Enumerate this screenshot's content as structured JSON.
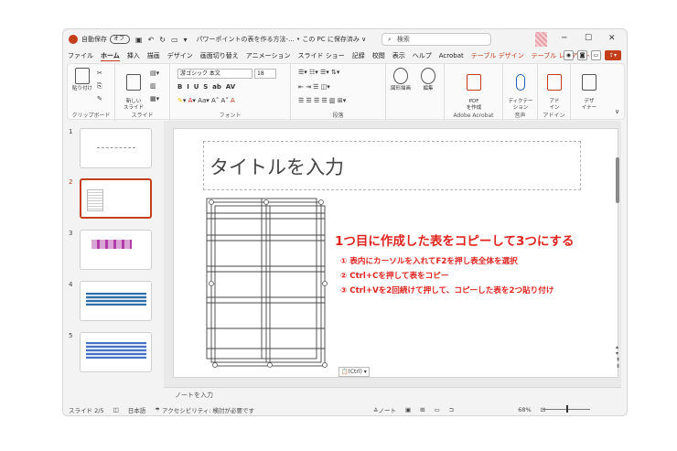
{
  "titlebar": {
    "autosave": "自動保存",
    "toggle": "オフ",
    "docname": "パワーポイントの表を作る方法-... • この PC に保存済み ∨",
    "search_placeholder": "検索",
    "minimize": "─",
    "maximize": "☐",
    "close": "✕"
  },
  "tabs": [
    "ファイル",
    "ホーム",
    "挿入",
    "描画",
    "デザイン",
    "画面切り替え",
    "アニメーション",
    "スライド ショー",
    "記録",
    "校閲",
    "表示",
    "ヘルプ",
    "Acrobat",
    "テーブル デザイン",
    "テーブル レイアウト"
  ],
  "active_tab": "ホーム",
  "ribbon": {
    "paste": "貼り付け",
    "new_slide": "新しい\nスライド",
    "font_name": "游ゴシック 本文",
    "font_size": "18",
    "draw_shape": "図形描画",
    "edit": "編集",
    "pdf": "PDF\nを作成",
    "dictate": "ディクテー\nション",
    "addins": "アド\nイン",
    "designer": "デザ\nイナー",
    "groups": [
      "クリップボード",
      "スライド",
      "フォント",
      "段落",
      "Adobe Acrobat",
      "音声",
      "アドイン"
    ]
  },
  "thumbnails": [
    "1",
    "2",
    "3",
    "4",
    "5"
  ],
  "slide": {
    "title_placeholder": "タイトルを入力",
    "annotation_heading": "1つ目に作成した表をコピーして3つにする",
    "steps": [
      "① 表内にカーソルを入れてF2を押し表全体を選択",
      "② Ctrl+Cを押して表をコピー",
      "③ Ctrl+Vを2回続けて押して、コピーした表を2つ貼り付け"
    ],
    "paste_tag": "(Ctrl) ▾"
  },
  "notes": "ノートを入力",
  "statusbar": {
    "slide_info": "スライド 2/5",
    "language": "日本語",
    "accessibility": "アクセシビリティ: 検討が必要です",
    "notes_btn": "ノート",
    "zoom": "68%"
  },
  "colors": {
    "accent": "#c43e1c",
    "annotation": "#e0241f"
  }
}
